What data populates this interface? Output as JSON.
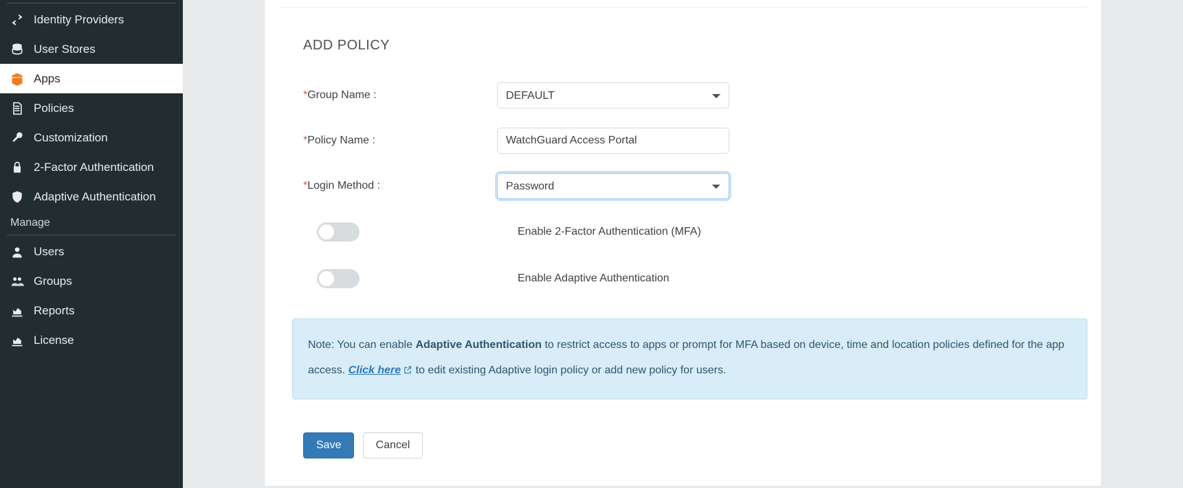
{
  "sidebar": {
    "items": [
      {
        "label": "Identity Providers",
        "icon": "swap-icon"
      },
      {
        "label": "User Stores",
        "icon": "database-icon"
      },
      {
        "label": "Apps",
        "icon": "box-icon",
        "active": true
      },
      {
        "label": "Policies",
        "icon": "document-icon"
      },
      {
        "label": "Customization",
        "icon": "wrench-icon"
      },
      {
        "label": "2-Factor Authentication",
        "icon": "lock-icon"
      },
      {
        "label": "Adaptive Authentication",
        "icon": "shield-icon"
      }
    ],
    "manage_label": "Manage",
    "manage_items": [
      {
        "label": "Users",
        "icon": "user-icon"
      },
      {
        "label": "Groups",
        "icon": "users-icon"
      },
      {
        "label": "Reports",
        "icon": "chart-icon"
      },
      {
        "label": "License",
        "icon": "chart-icon"
      }
    ]
  },
  "page": {
    "title": "ADD POLICY"
  },
  "form": {
    "group_name_label": "Group Name :",
    "group_name_value": "DEFAULT",
    "policy_name_label": "Policy Name :",
    "policy_name_value": "WatchGuard Access Portal",
    "login_method_label": "Login Method :",
    "login_method_value": "Password",
    "toggle_mfa_label": "Enable 2-Factor Authentication (MFA)",
    "toggle_mfa_on": false,
    "toggle_adaptive_label": "Enable Adaptive Authentication",
    "toggle_adaptive_on": false
  },
  "note": {
    "prefix": "Note: You can enable ",
    "bold": "Adaptive Authentication",
    "mid": " to restrict access to apps or prompt for MFA based on device, time and location policies defined for the app access. ",
    "link": "Click here",
    "suffix": " to edit existing Adaptive login policy or add new policy for users."
  },
  "buttons": {
    "save": "Save",
    "cancel": "Cancel"
  }
}
